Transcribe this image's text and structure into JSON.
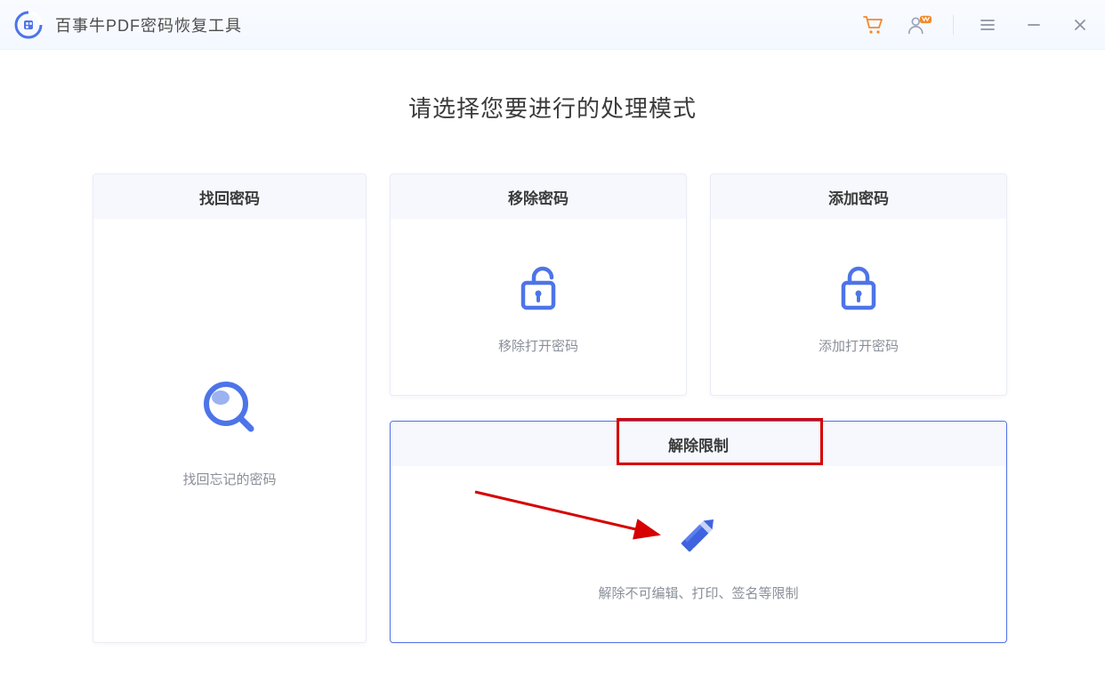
{
  "app": {
    "title": "百事牛PDF密码恢复工具"
  },
  "main": {
    "heading": "请选择您要进行的处理模式"
  },
  "cards": {
    "recover": {
      "title": "找回密码",
      "desc": "找回忘记的密码"
    },
    "remove": {
      "title": "移除密码",
      "desc": "移除打开密码"
    },
    "add": {
      "title": "添加密码",
      "desc": "添加打开密码"
    },
    "unrestrict": {
      "title": "解除限制",
      "desc": "解除不可编辑、打印、签名等限制"
    }
  },
  "colors": {
    "accent": "#4f6fe6",
    "iconBlue": "#4d74e8",
    "orange": "#f28a2a",
    "highlight": "#d60000"
  }
}
